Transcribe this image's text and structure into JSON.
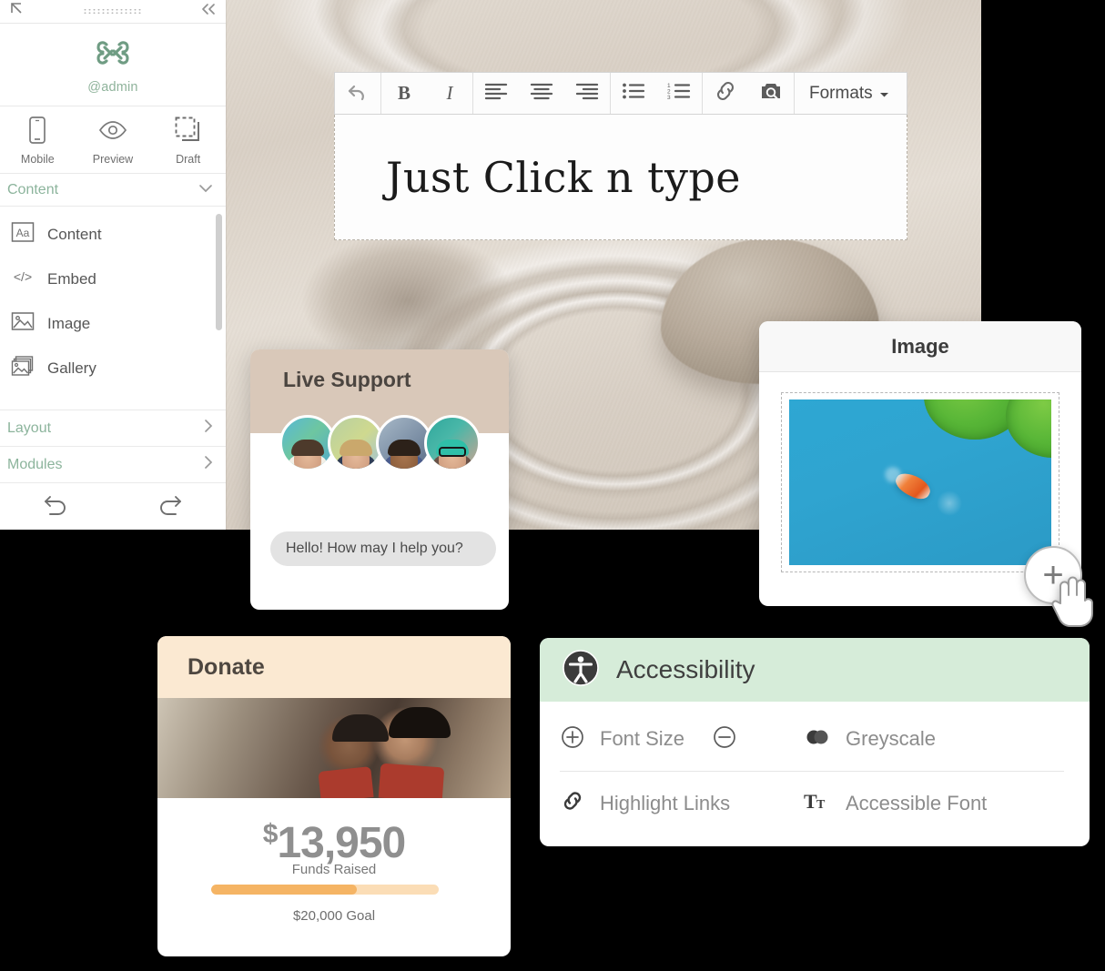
{
  "sidebar": {
    "topbar": {
      "cursor_icon": "arrow-cursor-icon",
      "grip_icon": "drag-grip-icon",
      "collapse_icon": "double-chevron-left-icon"
    },
    "profile": {
      "logo_icon": "joomla-logo-icon",
      "handle": "@admin",
      "accent": "#8fb39b"
    },
    "actions": [
      {
        "label": "Mobile",
        "icon": "mobile-phone-icon"
      },
      {
        "label": "Preview",
        "icon": "eye-icon"
      },
      {
        "label": "Draft",
        "icon": "dashed-frame-icon"
      }
    ],
    "content_section": {
      "label": "Content",
      "chevron": "chevron-down-icon"
    },
    "items": [
      {
        "label": "Content",
        "icon": "aa-text-icon"
      },
      {
        "label": "Embed",
        "icon": "code-brackets-icon"
      },
      {
        "label": "Image",
        "icon": "picture-icon"
      },
      {
        "label": "Gallery",
        "icon": "gallery-stack-icon"
      }
    ],
    "rows": [
      {
        "label": "Layout",
        "chevron": "chevron-right-icon"
      },
      {
        "label": "Modules",
        "chevron": "chevron-right-icon"
      }
    ],
    "undo_icon": "undo-arrow-icon",
    "redo_icon": "redo-arrow-icon"
  },
  "editor": {
    "toolbar": {
      "groups": [
        [
          {
            "name": "undo",
            "icon": "undo-arrow-icon"
          }
        ],
        [
          {
            "name": "bold",
            "label": "B"
          },
          {
            "name": "italic",
            "label": "I"
          }
        ],
        [
          {
            "name": "align-left",
            "icon": "align-left-icon"
          },
          {
            "name": "align-center",
            "icon": "align-center-icon"
          },
          {
            "name": "align-right",
            "icon": "align-right-icon"
          }
        ],
        [
          {
            "name": "bullet-list",
            "icon": "bullet-list-icon"
          },
          {
            "name": "numbered-list",
            "icon": "numbered-list-icon"
          }
        ],
        [
          {
            "name": "insert-link",
            "icon": "link-chain-icon"
          },
          {
            "name": "media-manager",
            "icon": "image-search-icon"
          }
        ]
      ],
      "formats_label": "Formats",
      "formats_caret": "caret-down-icon"
    },
    "body_text": "Just Click n type"
  },
  "live_support": {
    "title": "Live Support",
    "header_color": "#d9c8b9",
    "message": "Hello! How may I help you?",
    "agents": [
      "agent-1",
      "agent-2",
      "agent-3",
      "agent-4"
    ]
  },
  "image_widget": {
    "title": "Image",
    "photo_alt": "koi-fish-pond-photo",
    "add_button_label": "+",
    "cursor_icon": "pointing-hand-cursor-icon"
  },
  "donate": {
    "title": "Donate",
    "header_color": "#fbe9d2",
    "photo_alt": "volunteers-in-aprons-photo",
    "currency_symbol": "$",
    "amount": "13,950",
    "amount_caption": "Funds Raised",
    "goal_label": "$20,000 Goal",
    "progress_percent": 64,
    "bar_fill_color": "#f5b464",
    "bar_track_color": "#fbddb6"
  },
  "accessibility": {
    "title": "Accessibility",
    "header_color": "#d6ecd9",
    "badge_icon": "accessibility-person-icon",
    "options": [
      {
        "label": "Font Size",
        "icon": "plus-circle-icon",
        "secondary_icon": "minus-circle-icon"
      },
      {
        "label": "Greyscale",
        "icon": "two-circles-icon"
      },
      {
        "label": "Highlight Links",
        "icon": "link-chain-icon"
      },
      {
        "label": "Accessible Font",
        "icon": "tt-font-icon"
      }
    ]
  }
}
